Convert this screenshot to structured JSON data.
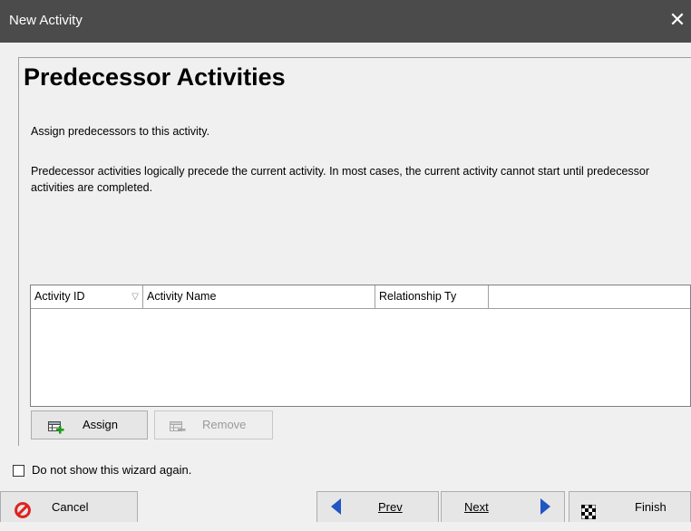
{
  "window": {
    "title": "New Activity",
    "close_glyph": "✕"
  },
  "page": {
    "heading": "Predecessor Activities",
    "intro": "Assign predecessors to this activity.",
    "description": "Predecessor activities logically precede the current activity.  In most cases, the current activity cannot start until predecessor activities are completed."
  },
  "grid": {
    "columns": [
      "Activity ID",
      "Activity Name",
      "Relationship Ty"
    ],
    "sort_glyph": "▽",
    "rows": []
  },
  "actions": {
    "assign_label": "Assign",
    "remove_label": "Remove"
  },
  "wizard": {
    "dont_show_label": "Do not show this wizard again.",
    "dont_show_checked": false
  },
  "nav": {
    "cancel_label": "Cancel",
    "prev_label": "Prev",
    "next_label": "Next",
    "finish_label": "Finish"
  },
  "colors": {
    "titlebar": "#4b4b4b",
    "nav_arrow": "#2255c4",
    "cancel_icon": "#e02020",
    "assign_icon_green": "#1a9e1a"
  },
  "icons": {
    "close": "close-icon",
    "assign": "assign-add-icon",
    "remove": "remove-icon",
    "cancel": "cancel-icon",
    "prev": "prev-arrow-icon",
    "next": "next-arrow-icon",
    "finish": "checkered-flag-icon"
  }
}
